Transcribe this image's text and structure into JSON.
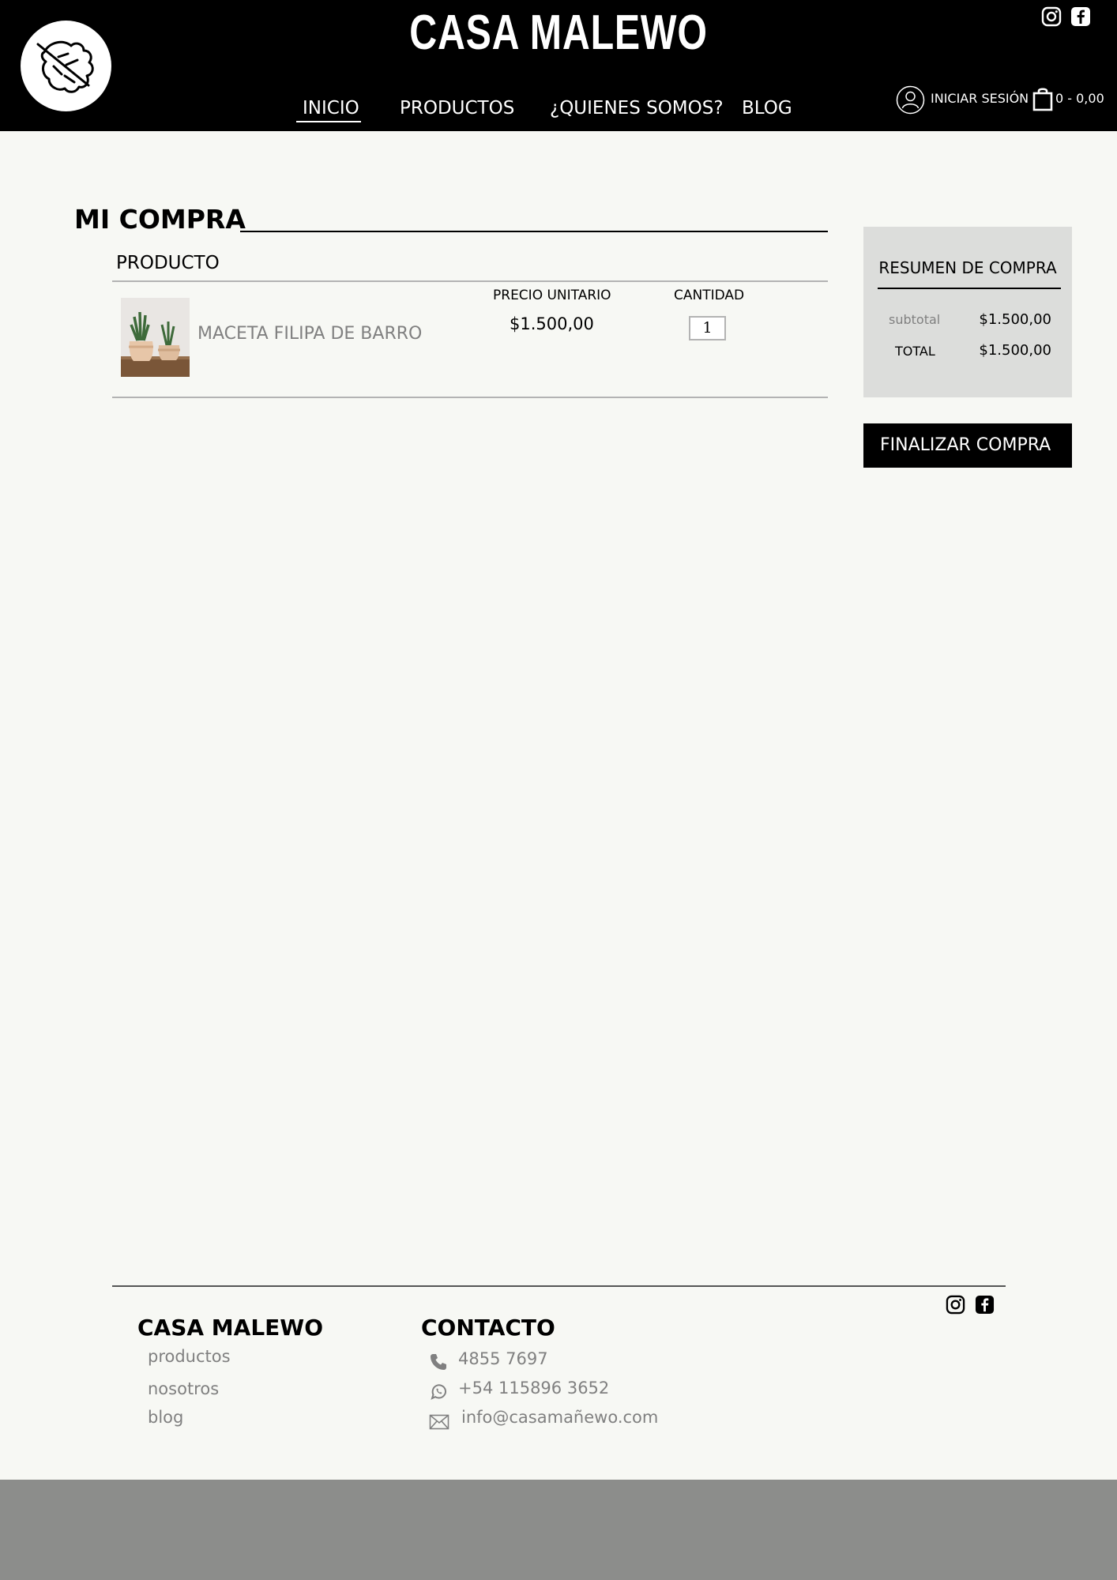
{
  "header": {
    "brand": "CASA MALEWO",
    "nav": [
      "INICIO",
      "PRODUCTOS",
      "¿QUIENES SOMOS?",
      "BLOG"
    ],
    "active_nav": "INICIO",
    "login": "INICIAR SESIÓN",
    "cart": "0 - 0,00",
    "social_icons": [
      "instagram-icon",
      "facebook-icon"
    ]
  },
  "cart": {
    "title": "MI COMPRA",
    "product_header": "PRODUCTO",
    "unit_price_header": "PRECIO UNITARIO",
    "quantity_header": "CANTIDAD",
    "items": [
      {
        "name": "MACETA FILIPA DE BARRO",
        "unit_price": "$1.500,00",
        "quantity": "1"
      }
    ]
  },
  "summary": {
    "title": "RESUMEN DE COMPRA",
    "subtotal_label": "subtotal",
    "subtotal_value": "$1.500,00",
    "total_label": "TOTAL",
    "total_value": "$1.500,00",
    "checkout": "FINALIZAR COMPRA"
  },
  "footer": {
    "brand": "CASA MALEWO",
    "links": [
      "productos",
      "nosotros",
      "blog"
    ],
    "contact_title": "CONTACTO",
    "phone": "4855 7697",
    "whatsapp": "+54 115896 3652",
    "email": "info@casamañewo.com"
  },
  "colors": {
    "header_bg": "#000000",
    "page_bg": "#f7f8f4",
    "summary_bg": "#dcdddb",
    "muted_text": "#808080",
    "bottom_band": "#8c8d8b"
  }
}
